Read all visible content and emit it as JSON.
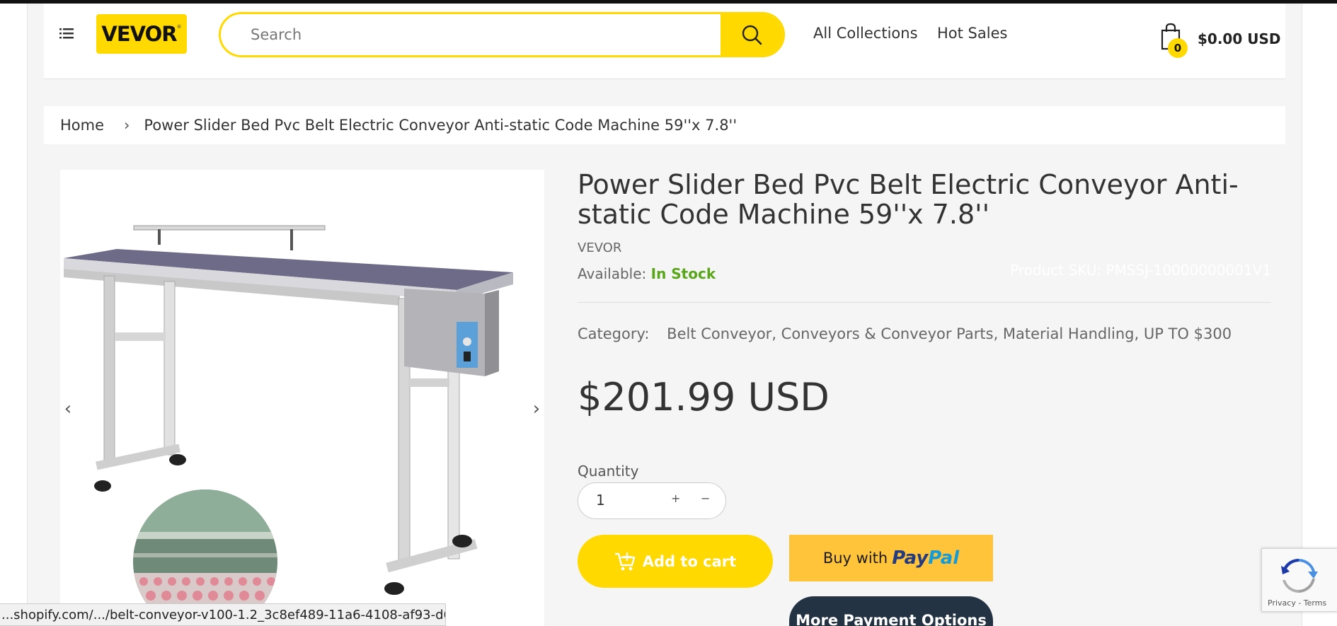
{
  "header": {
    "logo_text": "VEVOR",
    "logo_mark": "®",
    "search_placeholder": "Search",
    "nav": [
      "All Collections",
      "Hot Sales"
    ],
    "cart_count": "0",
    "cart_total": "$0.00 USD"
  },
  "breadcrumb": {
    "home": "Home",
    "separator": "›",
    "current": "Power Slider Bed Pvc Belt Electric Conveyor Anti-static Code Machine 59''x 7.8''"
  },
  "product": {
    "title": "Power Slider Bed Pvc Belt Electric Conveyor Anti-static Code Machine 59''x 7.8''",
    "vendor": "VEVOR",
    "available_label": "Available:",
    "available_value": "In Stock",
    "sku_label": "Product SKU: PMSSJ-10000000001V1",
    "category_label": "Category:",
    "categories": "Belt Conveyor, Conveyors & Conveyor Parts, Material Handling, UP TO $300",
    "price": "$201.99 USD",
    "quantity_label": "Quantity",
    "quantity_value": "1",
    "plus": "+",
    "minus": "−"
  },
  "buttons": {
    "add_to_cart": "Add to cart",
    "buy_with": "Buy with",
    "paypal_1": "Pay",
    "paypal_2": "Pal",
    "more_payment": "More Payment Options"
  },
  "gallery": {
    "prev": "‹",
    "next": "›"
  },
  "recaptcha": {
    "text": "Privacy - Terms"
  },
  "status_bar": {
    "url": "...shopify.com/.../belt-conveyor-v100-1.2_3c8ef489-11a6-4108-af93-d6acfd4..."
  },
  "colors": {
    "brand_yellow": "#ffd900",
    "in_stock_green": "#5aa61a",
    "paypal_yellow": "#ffc43a",
    "dark_button": "#233343"
  },
  "icons": {
    "menu": "hamburger-list-icon",
    "search": "magnifier-icon",
    "cart": "shopping-bag-icon",
    "add_cart": "cart-plus-icon",
    "recaptcha": "recaptcha-icon"
  }
}
